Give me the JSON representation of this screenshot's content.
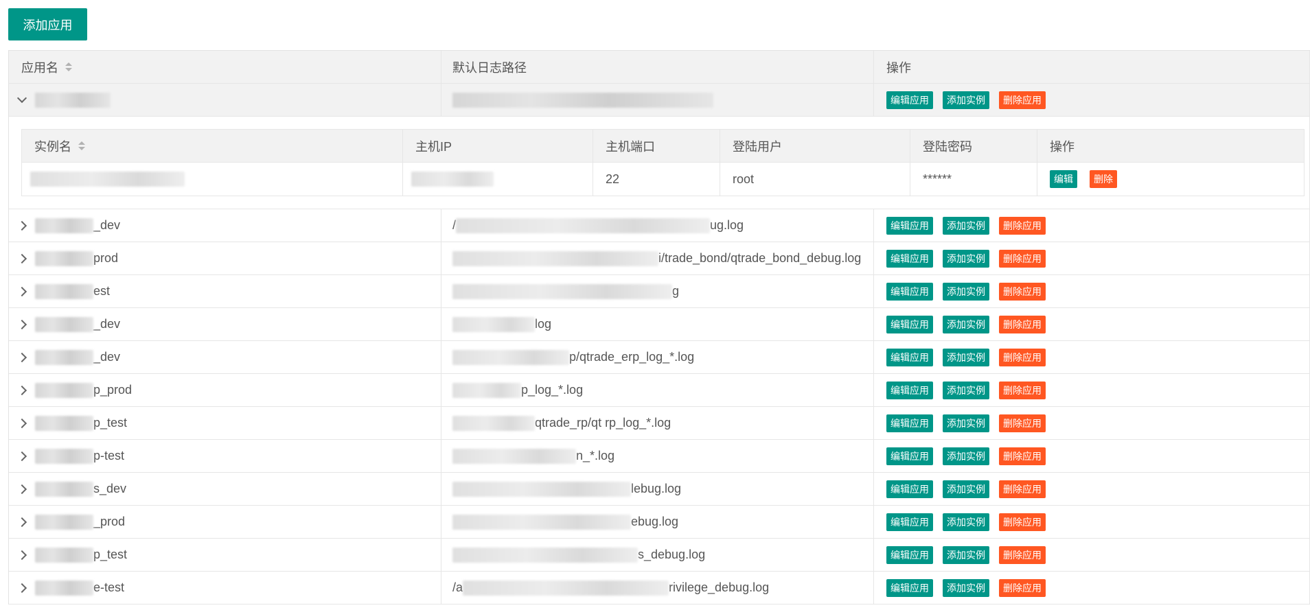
{
  "toolbar": {
    "add_app_label": "添加应用"
  },
  "table": {
    "headers": {
      "app_name": "应用名",
      "log_path": "默认日志路径",
      "actions": "操作"
    },
    "action_labels": {
      "edit": "编辑应用",
      "add_instance": "添加实例",
      "delete": "删除应用"
    }
  },
  "expanded_app": {
    "name": "",
    "log_path": "",
    "instances": {
      "headers": {
        "name": "实例名",
        "ip": "主机IP",
        "port": "主机端口",
        "user": "登陆用户",
        "password": "登陆密码",
        "actions": "操作"
      },
      "rows": [
        {
          "name": "",
          "ip": "",
          "port": "22",
          "user": "root",
          "password": "******"
        }
      ],
      "action_labels": {
        "edit": "编辑",
        "delete": "删除"
      }
    }
  },
  "apps": [
    {
      "name_suffix": "_dev",
      "log_suffix": "ug.log"
    },
    {
      "name_suffix": "prod",
      "log_suffix": "i/trade_bond/qtrade_bond_debug.log"
    },
    {
      "name_suffix": "est",
      "log_suffix": "g"
    },
    {
      "name_suffix": "_dev",
      "log_suffix": "log"
    },
    {
      "name_suffix": "_dev",
      "log_suffix": "p/qtrade_erp_log_*.log"
    },
    {
      "name_suffix": "p_prod",
      "log_suffix": "p_log_*.log"
    },
    {
      "name_suffix": "p_test",
      "log_suffix": "qtrade_rp/qt rp_log_*.log"
    },
    {
      "name_suffix": "p-test",
      "log_suffix": "n_*.log"
    },
    {
      "name_suffix": "s_dev",
      "log_suffix": "lebug.log"
    },
    {
      "name_suffix": "_prod",
      "log_suffix": "ebug.log"
    },
    {
      "name_suffix": "p_test",
      "log_suffix": "s_debug.log"
    },
    {
      "name_suffix": "e-test",
      "log_suffix": "rivilege_debug.log"
    }
  ],
  "apps_log_prefix": {
    "0": "/",
    "11": "/a"
  }
}
